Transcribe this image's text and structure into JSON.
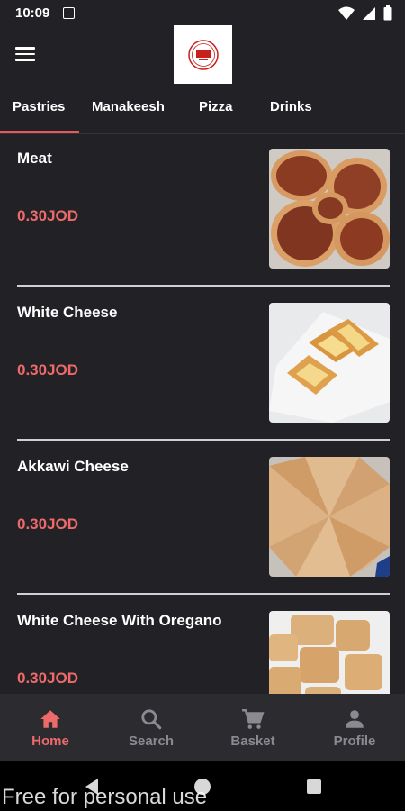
{
  "status": {
    "time": "10:09"
  },
  "header": {
    "menu_icon": "menu-icon",
    "logo_icon": "restaurant-logo"
  },
  "tabs": [
    {
      "label": "Pastries",
      "active": true
    },
    {
      "label": "Manakeesh",
      "active": false
    },
    {
      "label": "Pizza",
      "active": false
    },
    {
      "label": "Drinks",
      "active": false
    }
  ],
  "items": [
    {
      "name": "Meat",
      "price": "0.30JOD",
      "image": "meat-pastry"
    },
    {
      "name": "White Cheese",
      "price": "0.30JOD",
      "image": "white-cheese-pastry"
    },
    {
      "name": "Akkawi Cheese",
      "price": "0.30JOD",
      "image": "akkawi-cheese-pastry"
    },
    {
      "name": "White Cheese With Oregano",
      "price": "0.30JOD",
      "image": "oregano-cheese-pastry"
    }
  ],
  "bottom_nav": [
    {
      "label": "Home",
      "icon": "home-icon",
      "active": true
    },
    {
      "label": "Search",
      "icon": "search-icon",
      "active": false
    },
    {
      "label": "Basket",
      "icon": "cart-icon",
      "active": false
    },
    {
      "label": "Profile",
      "icon": "profile-icon",
      "active": false
    }
  ],
  "watermark": "Free for personal use",
  "colors": {
    "background": "#222226",
    "accent": "#ee6a6a",
    "nav_bg": "#2b2b30",
    "inactive": "#8a8a90"
  }
}
